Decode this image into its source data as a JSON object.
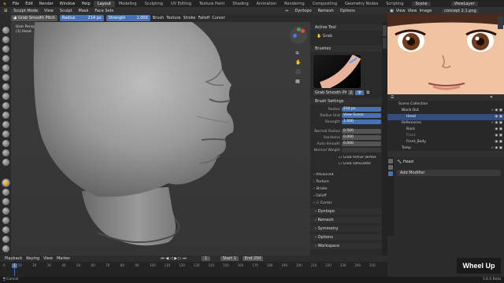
{
  "topbar": {
    "menus": [
      "File",
      "Edit",
      "Render",
      "Window",
      "Help"
    ],
    "workspaces": [
      "Layout",
      "Modeling",
      "Sculpting",
      "UV Editing",
      "Texture Paint",
      "Shading",
      "Animation",
      "Rendering",
      "Compositing",
      "Geometry Nodes",
      "Scripting"
    ],
    "scene": "Scene",
    "view_layer": "ViewLayer"
  },
  "header": {
    "mode": "Sculpt Mode",
    "menus": [
      "View",
      "Sculpt",
      "Mask",
      "Face Sets"
    ],
    "right_menus": [
      "Dyntopo",
      "Remesh",
      "Options"
    ]
  },
  "tool": {
    "brush": "Grab Smooth Pitch",
    "radius_label": "Radius",
    "radius": "214 px",
    "strength_label": "Strength",
    "strength": "1.000",
    "menus": [
      "Brush",
      "Texture",
      "Stroke",
      "Falloff",
      "Cursor"
    ]
  },
  "viewport": {
    "info1": "User Perspective",
    "info2": "(1) Head"
  },
  "props": {
    "active_tool": "Active Tool",
    "tool_name": "Grab",
    "brushes": "Brushes",
    "brush_name": "Grab Smooth Pitch",
    "brush_users": "2",
    "brush_settings": "Brush Settings",
    "rows": [
      {
        "label": "Radius",
        "value": "214 px",
        "hl": true
      },
      {
        "label": "Radius Unit",
        "value": "View   Scene",
        "hl": false
      },
      {
        "label": "Strength",
        "value": "1.000",
        "hl": true
      },
      {
        "label": "Normal Radius",
        "value": "0.500",
        "hl": false
      },
      {
        "label": "Hardness",
        "value": "0.000",
        "hl": false
      },
      {
        "label": "Auto-Smooth",
        "value": "0.000",
        "hl": false
      },
      {
        "label": "Normal Weight",
        "value": "",
        "hl": false
      }
    ],
    "checks": [
      "Grab Active Vertex",
      "Grab Silhouette"
    ],
    "subs": [
      "Advanced",
      "Texture",
      "Stroke",
      "Falloff",
      "Cursor"
    ],
    "panels": [
      "Dyntopo",
      "Remesh",
      "Symmetry",
      "Options",
      "Workspace"
    ]
  },
  "outliner": {
    "title": "Scene Collection",
    "rows": [
      {
        "name": "Block Out",
        "indent": 1
      },
      {
        "name": "Head",
        "indent": 2,
        "active": true
      },
      {
        "name": "References",
        "indent": 1
      },
      {
        "name": "Back",
        "indent": 2
      },
      {
        "name": "Front",
        "indent": 2
      },
      {
        "name": "Front_Body",
        "indent": 2
      },
      {
        "name": "Temp",
        "indent": 1
      }
    ]
  },
  "objprops": {
    "object": "Head",
    "add_modifier": "Add Modifier"
  },
  "reference": {
    "menus": [
      "View",
      "View",
      "Image"
    ],
    "file": "concept 2.1.png"
  },
  "timeline": {
    "menus": [
      "Playback",
      "Keying",
      "View",
      "Marker"
    ],
    "current_frame": "1",
    "start_label": "Start",
    "start": "1",
    "end_label": "End",
    "end": "250",
    "ticks": [
      "0",
      "10",
      "20",
      "30",
      "40",
      "50",
      "60",
      "70",
      "80",
      "90",
      "100",
      "110",
      "120",
      "130",
      "140",
      "150",
      "160",
      "170",
      "180",
      "190",
      "200",
      "210",
      "220",
      "230",
      "240",
      "250"
    ]
  },
  "status": {
    "left": "Cancel",
    "version": "3.6.0 Beta"
  },
  "overlay": "Wheel Up"
}
